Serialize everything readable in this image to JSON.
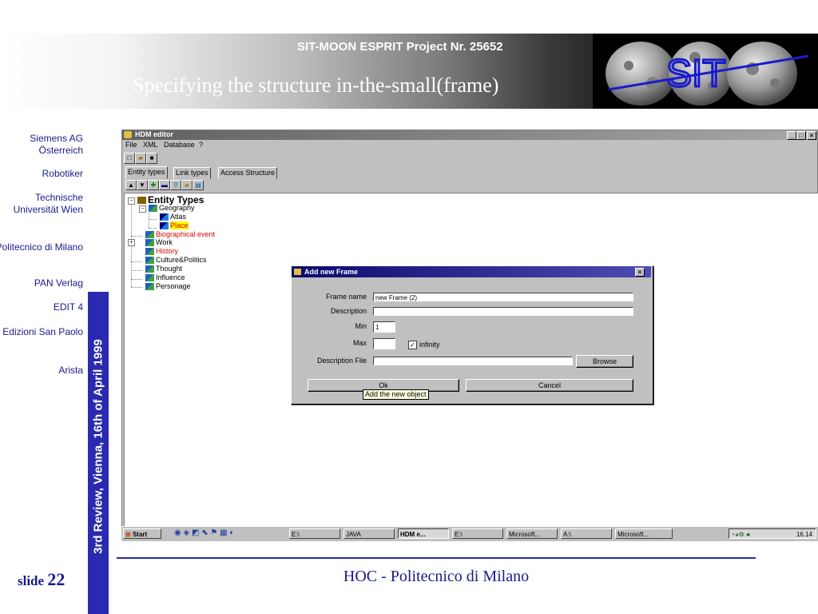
{
  "slide": {
    "project_title": "SIT-MOON ESPRIT Project Nr. 25652",
    "slide_title": "Specifying the structure in-the-small(frame)",
    "logo_text": "SIT",
    "partners": [
      "Siemens AG Österreich",
      "Robotiker",
      "Technische Universität Wien",
      "Politecnico di Milano",
      "PAN Verlag",
      "EDIT 4",
      "Edizioni San Paolo",
      "Arista"
    ],
    "vertical_text": "3rd Review, Vienna, 16th of April 1999",
    "slide_label": "slide",
    "slide_number": "22",
    "footer": "HOC - Politecnico di Milano"
  },
  "app": {
    "title": "HDM editor",
    "window_buttons": [
      "_",
      "□",
      "×"
    ],
    "menu": [
      "File",
      "XML",
      "Database",
      "?"
    ],
    "tabs": [
      "Entity types",
      "Link types",
      "Access Structure"
    ],
    "tree": {
      "root": "Entity Types",
      "nodes": [
        {
          "label": "Geography",
          "color": "#000000"
        },
        {
          "label": "Atlas",
          "color": "#000000"
        },
        {
          "label": "Place",
          "color": "#cc0000",
          "highlight": "#ffff00"
        },
        {
          "label": "Biographical event",
          "color": "#e00000"
        },
        {
          "label": "Work",
          "color": "#000000"
        },
        {
          "label": "History",
          "color": "#e00000"
        },
        {
          "label": "Culture&Politics",
          "color": "#000000"
        },
        {
          "label": "Thought",
          "color": "#000000"
        },
        {
          "label": "Influence",
          "color": "#000000"
        },
        {
          "label": "Personage",
          "color": "#000000"
        }
      ]
    }
  },
  "dialog": {
    "title": "Add new Frame",
    "close": "×",
    "labels": {
      "frame_name": "Frame name",
      "description": "Description",
      "min": "Min",
      "max": "Max",
      "description_file": "Description File"
    },
    "values": {
      "frame_name": "new Frame (2)",
      "description": "",
      "min": "1",
      "max": "",
      "description_file": ""
    },
    "infinity_label": "infinity",
    "infinity_checked": true,
    "browse": "Browse",
    "ok": "Ok",
    "cancel": "Cancel",
    "tooltip": "Add the new object"
  },
  "taskbar": {
    "start": "Start",
    "tasks": [
      "E:\\",
      "JAVA",
      "HDM e...",
      "E:\\",
      "Microsoft...",
      "A:\\",
      "Microsoft..."
    ],
    "clock": "16.14"
  }
}
